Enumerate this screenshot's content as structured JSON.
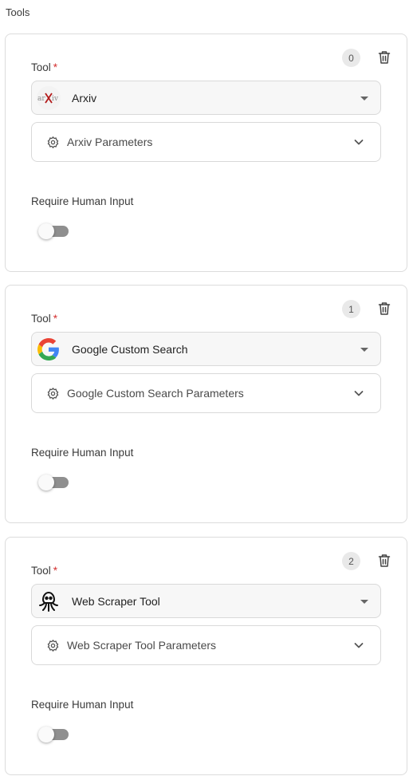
{
  "section_title": "Tools",
  "tools": [
    {
      "index": "0",
      "label": "Tool",
      "required_mark": "*",
      "name": "Arxiv",
      "logo": "arxiv-logo",
      "params_label": "Arxiv Parameters",
      "human_input_label": "Require Human Input",
      "human_input_enabled": false
    },
    {
      "index": "1",
      "label": "Tool",
      "required_mark": "*",
      "name": "Google Custom Search",
      "logo": "google-logo",
      "params_label": "Google Custom Search Parameters",
      "human_input_label": "Require Human Input",
      "human_input_enabled": false
    },
    {
      "index": "2",
      "label": "Tool",
      "required_mark": "*",
      "name": "Web Scraper Tool",
      "logo": "octopus-logo",
      "params_label": "Web Scraper Tool Parameters",
      "human_input_label": "Require Human Input",
      "human_input_enabled": false
    }
  ],
  "icons": {
    "delete": "trash-icon",
    "params": "gear-icon",
    "expand": "chevron-down-icon",
    "select": "caret-down-icon"
  },
  "colors": {
    "required": "#d32f2f",
    "toggle_off_track": "#8f8f8f",
    "card_border": "#dcdcdc"
  }
}
